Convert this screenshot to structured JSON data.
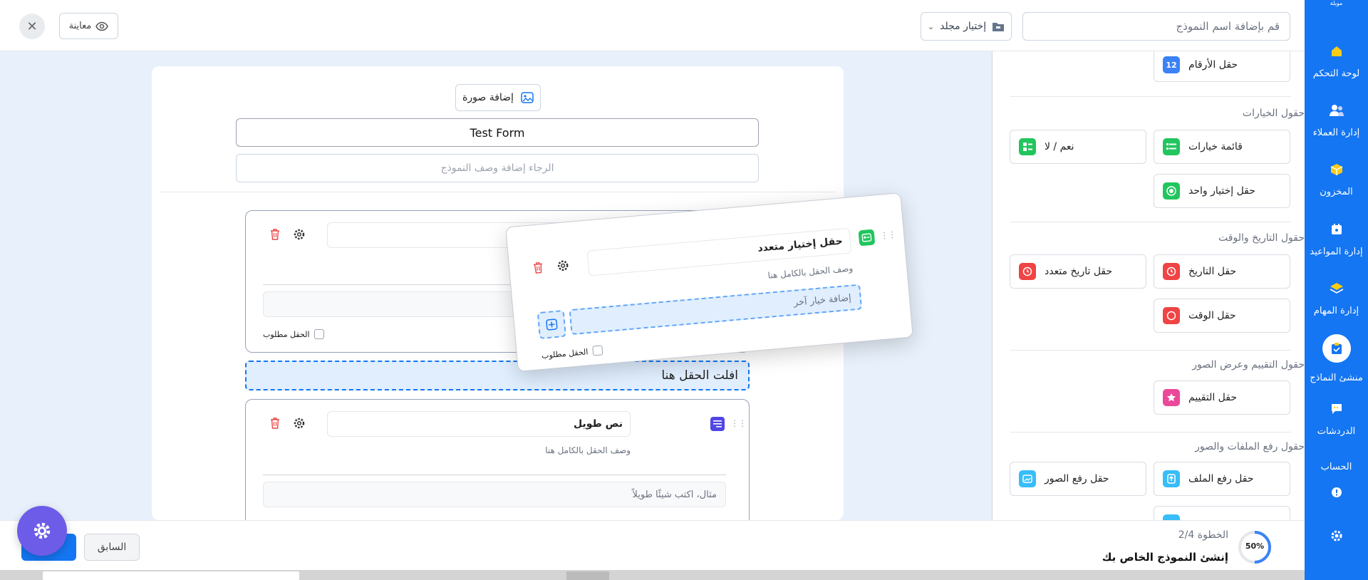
{
  "nav": {
    "brand": "مويلة",
    "items": [
      {
        "label": "لوحة التحكم",
        "icon": "home-icon"
      },
      {
        "label": "إدارة العملاء",
        "icon": "users-icon"
      },
      {
        "label": "المخزون",
        "icon": "box-icon"
      },
      {
        "label": "إدارة المواعيد",
        "icon": "calendar-icon"
      },
      {
        "label": "إدارة المهام",
        "icon": "layers-icon"
      },
      {
        "label": "منشئ النماذج",
        "icon": "clipboard-icon"
      },
      {
        "label": "الدردشات",
        "icon": "chat-icon"
      },
      {
        "label": "الحساب",
        "icon": "account-icon"
      }
    ]
  },
  "topbar": {
    "name_placeholder": "قم بإضافة اسم النموذج",
    "folder_label": "إختيار مجلد",
    "preview_label": "معاينة"
  },
  "fields_panel": {
    "number_field": "حقل الأرقام",
    "sections": [
      {
        "title": "حقول الخيارات",
        "buttons": [
          {
            "label": "قائمة خيارات",
            "icon": "list-icon",
            "color": "#22c55e"
          },
          {
            "label": "نعم / لا",
            "icon": "toggle-icon",
            "color": "#22c55e"
          },
          {
            "label": "حقل إختيار واحد",
            "icon": "radio-icon",
            "color": "#22c55e"
          }
        ]
      },
      {
        "title": "حقول التاريخ والوقت",
        "buttons": [
          {
            "label": "حقل التاريخ",
            "icon": "date-icon",
            "color": "#ef4444"
          },
          {
            "label": "حقل تاريخ متعدد",
            "icon": "multi-date-icon",
            "color": "#ef4444"
          },
          {
            "label": "حقل الوقت",
            "icon": "clock-icon",
            "color": "#ef4444"
          }
        ]
      },
      {
        "title": "حقول التقييم وعرض الصور",
        "buttons": [
          {
            "label": "حقل التقييم",
            "icon": "star-icon",
            "color": "#ec4899"
          }
        ]
      },
      {
        "title": "حقول رفع الملفات والصور",
        "buttons": [
          {
            "label": "حقل رفع الملف",
            "icon": "file-upload-icon",
            "color": "#38bdf8"
          },
          {
            "label": "حقل رفع الصور",
            "icon": "image-upload-icon",
            "color": "#38bdf8"
          }
        ]
      }
    ]
  },
  "canvas": {
    "add_image_label": "إضافة صورة",
    "form_title": "Test Form",
    "form_desc_placeholder": "الرجاء إضافة وصف النموذج",
    "drop_text": "افلت الحقل هنا",
    "required_label": "الحقل مطلوب",
    "long_text_card": {
      "title": "نص طويل",
      "desc_placeholder": "وصف الحقل بالكامل هنا",
      "answer_placeholder": "مثال، اكتب شيئًا طويلاً"
    }
  },
  "drag_card": {
    "title": "حقل إختيار متعدد",
    "desc_placeholder": "وصف الحقل بالكامل هنا",
    "add_option": "إضافة خيار آخر",
    "required_label": "الحقل مطلوب"
  },
  "bottombar": {
    "progress": "50%",
    "step": "الخطوة 2/4",
    "heading": "إنشئ النموذج الخاص بك",
    "prev_label": "السابق"
  },
  "colors": {
    "primary": "#1476f2",
    "fab": "#6d5ce8",
    "danger": "#ef4444",
    "drop_bg": "#e0eefe"
  }
}
